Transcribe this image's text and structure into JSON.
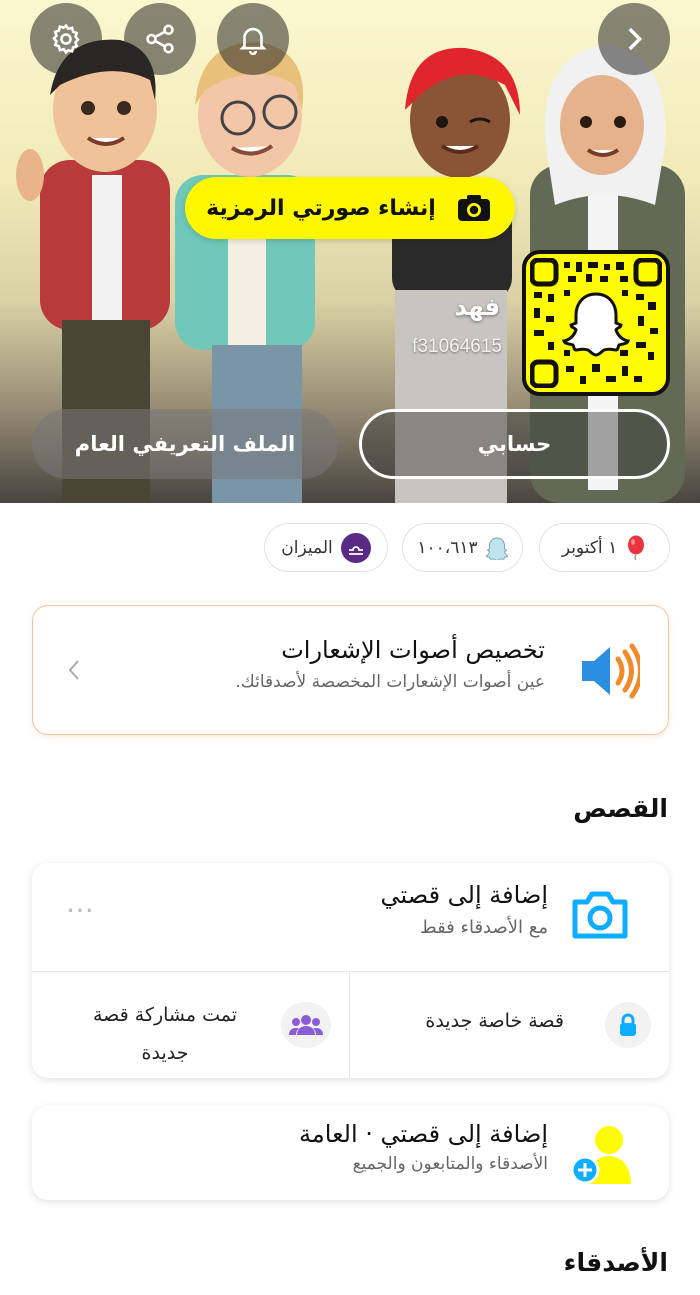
{
  "hero": {
    "create_avatar_label": "إنشاء صورتي الرمزية",
    "display_name": "فهد",
    "username": "f31064615",
    "account_button": "حسابي",
    "public_profile_button": "الملف التعريفي العام",
    "icons": [
      "gear-icon",
      "share-icon",
      "bell-icon",
      "chevron-right-icon",
      "camera-icon",
      "ghost-icon"
    ]
  },
  "chips": {
    "birthday": "١ أكتوبر",
    "score": "١٠٠،٦١٣",
    "zodiac": "الميزان"
  },
  "notification_card": {
    "title": "تخصيص أصوات الإشعارات",
    "subtitle": "عين أصوات الإشعارات المخصصة لأصدقائك."
  },
  "stories": {
    "section_title": "القصص",
    "add_story_title": "إضافة إلى قصتي",
    "add_story_subtitle": "مع الأصدقاء فقط",
    "more_icon": "⋯",
    "private_story": "قصة خاصة جديدة",
    "shared_story": "تمت مشاركة قصة جديدة",
    "public_story_title": "إضافة إلى قصتي · العامة",
    "public_story_subtitle": "الأصدقاء والمتابعون والجميع"
  },
  "friends": {
    "section_title": "الأصدقاء"
  },
  "colors": {
    "snap_yellow": "#FFFC00",
    "accent_blue": "#0FADFF",
    "purple": "#5b2a86"
  }
}
